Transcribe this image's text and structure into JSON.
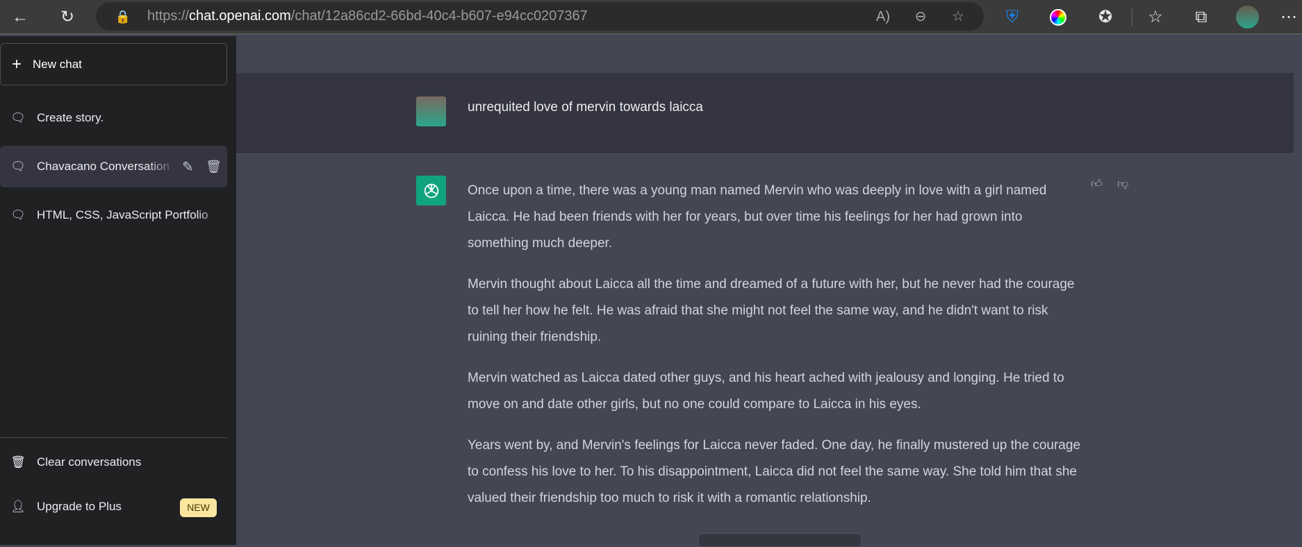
{
  "browser": {
    "url_scheme": "https://",
    "url_host": "chat.openai.com",
    "url_path": "/chat/12a86cd2-66bd-40c4-b607-e94cc0207367"
  },
  "sidebar": {
    "new_chat": "New chat",
    "items": [
      {
        "label": "Create story."
      },
      {
        "label": "Chavacano Conversation"
      },
      {
        "label": "HTML, CSS, JavaScript Portfolio"
      }
    ],
    "clear": "Clear conversations",
    "upgrade": "Upgrade to Plus",
    "badge": "NEW"
  },
  "conversation": {
    "user_message": "unrequited love of mervin towards laicca",
    "assistant_paragraphs": [
      "Once upon a time, there was a young man named Mervin who was deeply in love with a girl named Laicca. He had been friends with her for years, but over time his feelings for her had grown into something much deeper.",
      "Mervin thought about Laicca all the time and dreamed of a future with her, but he never had the courage to tell her how he felt. He was afraid that she might not feel the same way, and he didn't want to risk ruining their friendship.",
      "Mervin watched as Laicca dated other guys, and his heart ached with jealousy and longing. He tried to move on and date other girls, but no one could compare to Laicca in his eyes.",
      "Years went by, and Mervin's feelings for Laicca never faded. One day, he finally mustered up the courage to confess his love to her. To his disappointment, Laicca did not feel the same way. She told him that she valued their friendship too much to risk it with a romantic relationship."
    ]
  },
  "colors": {
    "sidebar": "#202123",
    "user_bg": "#343541",
    "assistant_bg": "#444654",
    "openai_green": "#10a37f",
    "badge": "#fae69e"
  }
}
